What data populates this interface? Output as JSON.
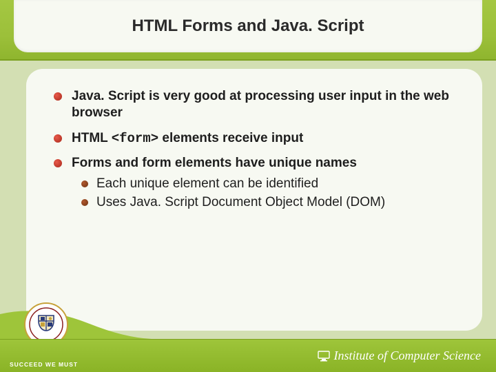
{
  "title": "HTML Forms and Java. Script",
  "bullets": [
    {
      "text": "Java. Script is very good at processing user input in the web browser"
    },
    {
      "pre": "HTML ",
      "code": "<form>",
      "post": " elements receive input"
    },
    {
      "text": "Forms and form elements have unique names",
      "sub": [
        "Each unique element can be identified",
        "Uses Java. Script Document Object Model (DOM)"
      ]
    }
  ],
  "footer": {
    "motto": "SUCCEED WE MUST",
    "institute": "Institute of Computer Science"
  }
}
